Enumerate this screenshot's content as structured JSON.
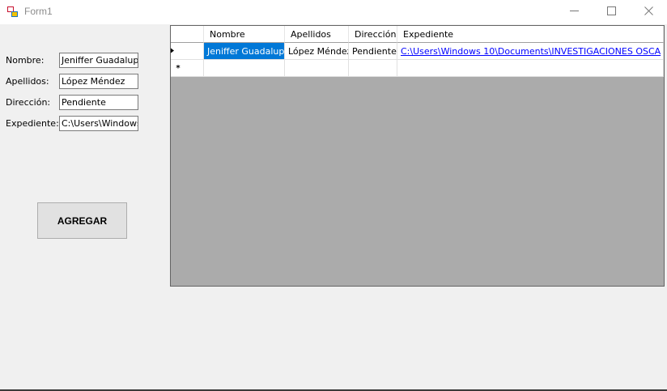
{
  "window": {
    "title": "Form1"
  },
  "form": {
    "nombre_label": "Nombre:",
    "nombre_value": "Jeniffer Guadalupe",
    "apellidos_label": "Apellidos:",
    "apellidos_value": "López Méndez",
    "direccion_label": "Dirección:",
    "direccion_value": "Pendiente",
    "expediente_label": "Expediente:",
    "expediente_value": "C:\\Users\\Windows",
    "agregar_label": "AGREGAR"
  },
  "grid": {
    "columns": [
      "Nombre",
      "Apellidos",
      "Dirección",
      "Expediente"
    ],
    "rows": [
      {
        "nombre": "Jeniffer Guadalupe",
        "apellidos": "López Méndez",
        "direccion": "Pendiente",
        "expediente": "C:\\Users\\Windows 10\\Documents\\INVESTIGACIONES OSCA"
      }
    ],
    "new_row_marker": "*",
    "selection_color": "#0078d7",
    "link_color": "#0000ff"
  },
  "icons": [
    "app-icon",
    "minimize-icon",
    "maximize-icon",
    "close-icon",
    "current-row-arrow-icon"
  ]
}
